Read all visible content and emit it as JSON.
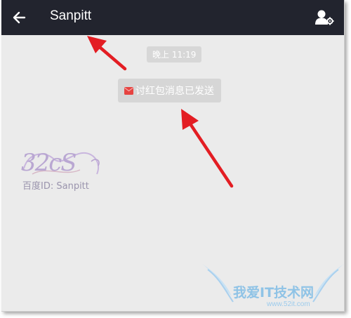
{
  "header": {
    "title": "Sanpitt",
    "back_icon": "arrow-left-icon",
    "profile_icon": "user-settings-icon"
  },
  "chat": {
    "timestamp": "晚上 11:19",
    "system_notice": "讨红包消息已发送",
    "notice_icon": "red-envelope-icon"
  },
  "watermarks": {
    "baidu_id": "百度ID: Sanpitt",
    "site_name": "我爱IT技术网",
    "site_url": "www.52it.com"
  },
  "colors": {
    "header_bg": "#22242e",
    "chat_bg": "#ebebeb",
    "pill_bg": "#d6d6d6",
    "arrow_red": "#e31d23",
    "envelope_red": "#e64340"
  }
}
